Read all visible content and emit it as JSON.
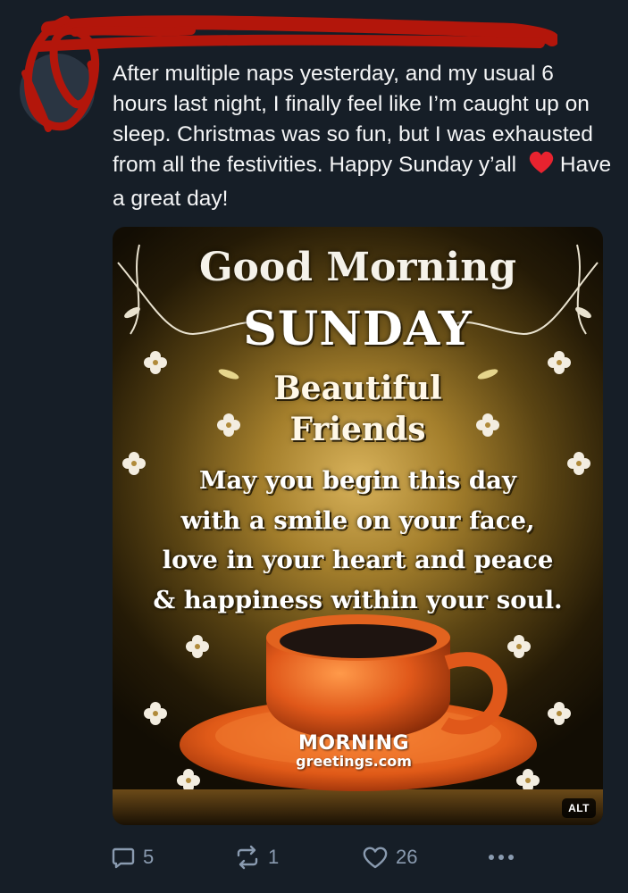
{
  "post": {
    "text": "After multiple naps yesterday, and my usual 6 hours last night, I finally feel like I’m caught up on sleep. Christmas was so fun, but I was exhausted from all the festivities. Happy Sunday y’all ",
    "text_after_emoji": "Have a great day!",
    "emoji": "red-heart"
  },
  "image": {
    "line1": "Good Morning",
    "line2": "SUNDAY",
    "line3": "Beautiful",
    "line4": "Friends",
    "message": "May you begin this day\nwith a smile on your face,\nlove in your heart and peace\n& happiness within your soul.",
    "brand_top": "MORNING",
    "brand_bottom": "greetings.com",
    "alt_label": "ALT"
  },
  "actions": {
    "replies": "5",
    "reposts": "1",
    "likes": "26"
  },
  "colors": {
    "background": "#161e27",
    "icon": "#8a9bb0",
    "redaction": "#b3160b"
  }
}
